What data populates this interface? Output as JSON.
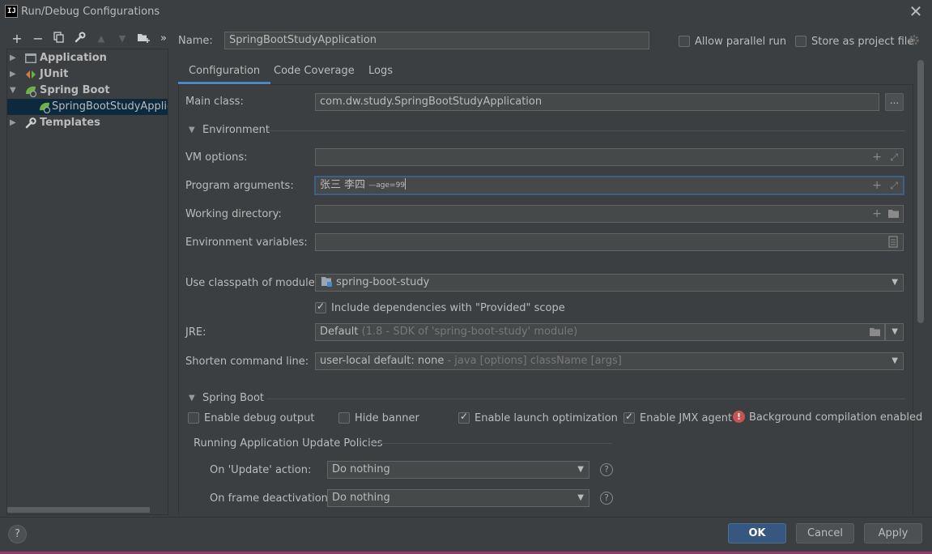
{
  "window": {
    "title": "Run/Debug Configurations",
    "icon_text": "IJ"
  },
  "toolbar": {
    "icons": [
      "plus-icon",
      "minus-icon",
      "copy-icon",
      "wrench-icon",
      "arrow-up-icon",
      "arrow-down-icon",
      "new-folder-icon",
      "more-icon"
    ],
    "more_label": "»"
  },
  "tree": {
    "items": [
      {
        "label": "Application",
        "expanded": false
      },
      {
        "label": "JUnit",
        "expanded": false
      },
      {
        "label": "Spring Boot",
        "expanded": true
      },
      {
        "label": "SpringBootStudyApplication",
        "selected": true
      },
      {
        "label": "Templates",
        "expanded": false
      }
    ]
  },
  "header": {
    "name_label": "Name:",
    "name_value": "SpringBootStudyApplication",
    "allow_parallel_label": "Allow parallel run",
    "store_label": "Store as project file"
  },
  "tabs": [
    {
      "label": "Configuration",
      "active": true
    },
    {
      "label": "Code Coverage",
      "active": false
    },
    {
      "label": "Logs",
      "active": false
    }
  ],
  "config": {
    "main_class_label": "Main class:",
    "main_class_value": "com.dw.study.SpringBootStudyApplication",
    "browse_label": "...",
    "environment_section": "Environment",
    "vm_options_label": "VM options:",
    "vm_options_value": "",
    "program_args_label": "Program arguments:",
    "program_args_main": "张三 李四 ",
    "program_args_small": "—age=99",
    "working_dir_label": "Working directory:",
    "working_dir_value": "",
    "env_vars_label": "Environment variables:",
    "env_vars_value": "",
    "classpath_label": "Use classpath of module:",
    "classpath_value": "spring-boot-study",
    "include_deps_label": "Include dependencies with \"Provided\" scope",
    "include_deps_checked": true,
    "jre_label": "JRE:",
    "jre_value": "Default",
    "jre_hint": "(1.8 - SDK of 'spring-boot-study' module)",
    "shorten_label": "Shorten command line:",
    "shorten_value": "user-local default: none",
    "shorten_hint": "- java [options] className [args]"
  },
  "spring_boot": {
    "section": "Spring Boot",
    "debug_output_label": "Enable debug output",
    "debug_output_checked": false,
    "hide_banner_label": "Hide banner",
    "hide_banner_checked": false,
    "launch_opt_label": "Enable launch optimization",
    "launch_opt_checked": true,
    "jmx_label": "Enable JMX agent",
    "jmx_checked": true,
    "bg_compile_label": "Background compilation enabled",
    "policies_heading": "Running Application Update Policies",
    "on_update_label": "On 'Update' action:",
    "on_update_value": "Do nothing",
    "on_frame_label": "On frame deactivation:",
    "on_frame_value": "Do nothing"
  },
  "footer": {
    "help_label": "?",
    "ok_label": "OK",
    "cancel_label": "Cancel",
    "apply_label": "Apply"
  },
  "colors": {
    "background": "#3c3f41",
    "selection": "#0d293e",
    "accent": "#4a88c7",
    "primary_button": "#365880",
    "error": "#c75450",
    "spring_green": "#6db33f"
  }
}
